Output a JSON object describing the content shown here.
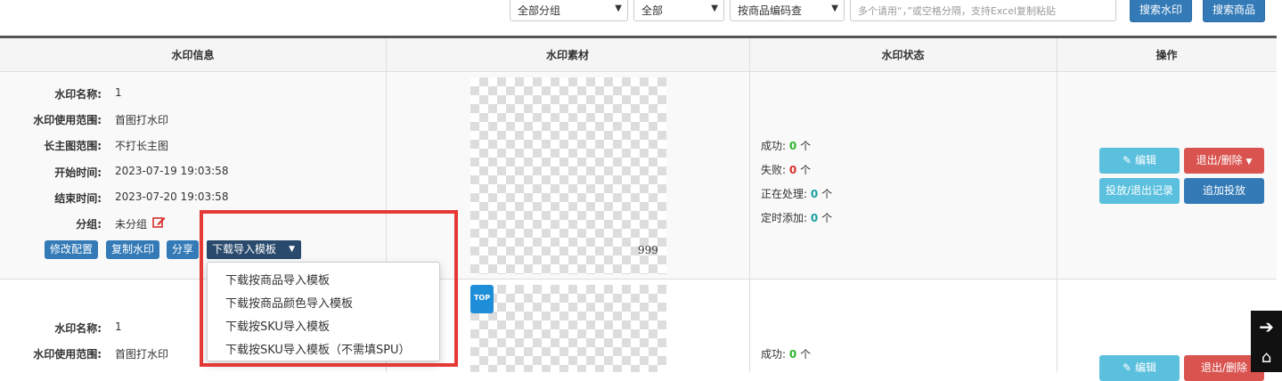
{
  "toolbar": {
    "group_select": "全部分组",
    "status_select": "全部",
    "search_type_select": "按商品编码查",
    "search_placeholder": "多个请用“，”或空格分隔，支持Excel复制粘贴",
    "search_watermark_label": "搜索水印",
    "search_product_label": "搜索商品"
  },
  "columns": [
    "水印信息",
    "水印素材",
    "水印状态",
    "操作"
  ],
  "rows": [
    {
      "info": [
        {
          "label": "水印名称:",
          "value": "1"
        },
        {
          "label": "水印使用范围:",
          "value": "首图打水印"
        },
        {
          "label": "长主图范围:",
          "value": "不打长主图"
        },
        {
          "label": "开始时间:",
          "value": "2023-07-19 19:03:58"
        },
        {
          "label": "结束时间:",
          "value": "2023-07-20 19:03:58"
        },
        {
          "label": "分组:",
          "value": "未分组"
        }
      ],
      "actions": [
        "修改配置",
        "复制水印",
        "分享",
        "下载导入模板"
      ],
      "material_caption": "999",
      "status": [
        {
          "label": "成功:",
          "count": "0",
          "unit": "个"
        },
        {
          "label": "失败:",
          "count": "0",
          "unit": "个"
        },
        {
          "label": "正在处理:",
          "count": "0",
          "unit": "个"
        },
        {
          "label": "定时添加:",
          "count": "0",
          "unit": "个"
        }
      ],
      "ops": {
        "edit": "编辑",
        "exit_delete": "退出/删除",
        "records": "投放/退出记录",
        "add_place": "追加投放"
      }
    },
    {
      "info": [
        {
          "label": "水印名称:",
          "value": "1"
        },
        {
          "label": "水印使用范围:",
          "value": "首图打水印"
        }
      ],
      "status": [
        {
          "label": "成功:",
          "count": "0",
          "unit": "个"
        }
      ],
      "ops": {
        "edit": "编辑",
        "exit_delete": "退出/删除"
      },
      "logo_text": "TOP"
    }
  ],
  "dropdown_items": [
    "下载按商品导入模板",
    "下载按商品颜色导入模板",
    "下载按SKU导入模板",
    "下载按SKU导入模板（不需填SPU）"
  ]
}
